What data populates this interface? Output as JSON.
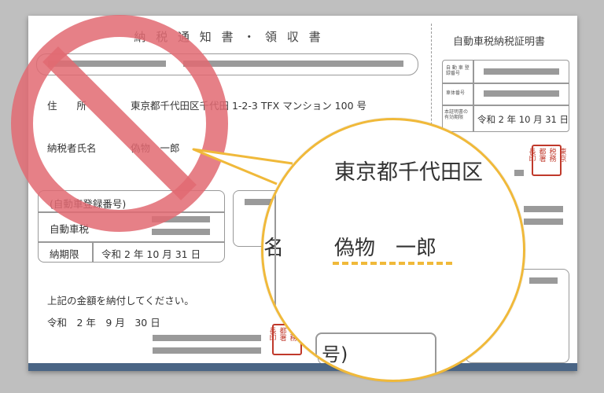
{
  "document": {
    "title": "納 税 通 知 書 ・ 領 収 書",
    "certificate_title": "自動車税納税証明書",
    "address_label": "住　　所",
    "address_value": "東京都千代田区千代田 1-2-3 TFX マンション 100 号",
    "taxpayer_label": "納税者氏名",
    "taxpayer_value": "偽物　一郎",
    "registration_label": "(自動車登録番号)",
    "tax_type": "自動車税",
    "deadline_label": "納期限",
    "deadline_value": "令和 2 年 10 月 31 日",
    "paid_notice": "上記の金額を納付してください。",
    "issue_date": "令和　2 年　9 月　30 日",
    "cert_row1_label": "自 動 車 登録番号",
    "cert_row2_label": "車体番号",
    "cert_row3_label": "本証明書の 有効期限",
    "cert_expiry": "令和 2 年 10 月 31 日",
    "seal_chars": [
      "東京",
      "税務",
      "都署",
      "長印"
    ],
    "seal_left_chars": [
      "東京",
      "税務",
      "都署",
      "長印"
    ]
  },
  "magnifier": {
    "address_zoom": "東京都千代田区",
    "name_label_zoom": "名",
    "name_zoom": "偽物　一郎",
    "paren_zoom": "号)"
  },
  "colors": {
    "prohibit_red": "#e26a72",
    "highlight_yellow": "#f0b93a",
    "seal_red": "#c0392b",
    "band_blue": "#4a6585"
  },
  "icons": {
    "prohibit": "prohibit-icon",
    "magnifier": "magnifier-callout"
  }
}
